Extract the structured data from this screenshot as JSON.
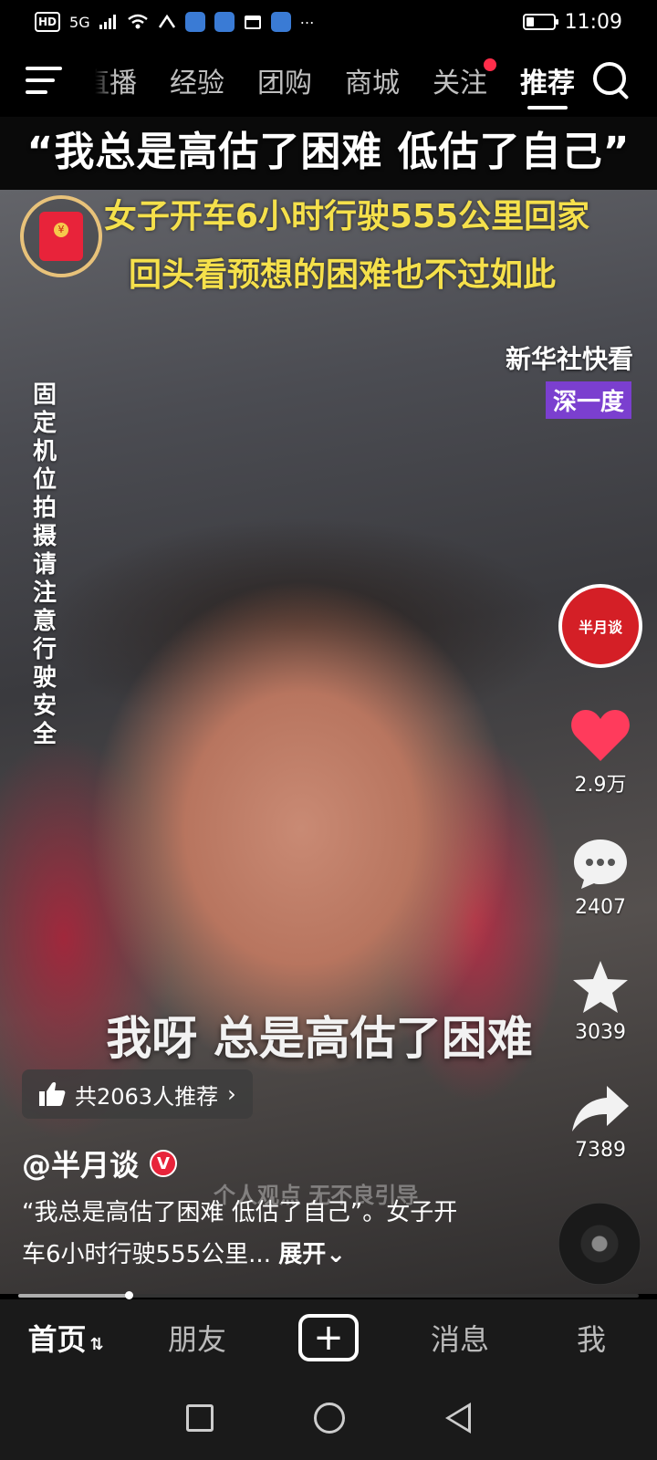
{
  "status_bar": {
    "network": "5G",
    "hd_label": "HD",
    "time": "11:09",
    "battery_level": 0.4
  },
  "top_nav": {
    "tabs": [
      {
        "label": "直播"
      },
      {
        "label": "经验"
      },
      {
        "label": "团购"
      },
      {
        "label": "商城"
      },
      {
        "label": "关注"
      },
      {
        "label": "推荐"
      }
    ],
    "active_tab": "推荐"
  },
  "video": {
    "title": "“我总是高估了困难 低估了自己”",
    "caption_line1": "女子开车6小时行驶555公里回家",
    "caption_line2": "回头看预想的困难也不过如此",
    "brand_mark": "新华社快看",
    "brand_sub": "深一度",
    "vertical_notice": "固定机位拍摄 请注意行驶安全",
    "subtitle": "我呀 总是高估了困难",
    "watermark": "个人观点 无不良引导"
  },
  "actions": {
    "avatar_text": "半月谈",
    "likes": "2.9万",
    "comments": "2407",
    "favorites": "3039",
    "shares": "7389"
  },
  "recommend": {
    "label": "共2063人推荐"
  },
  "post": {
    "author": "@半月谈",
    "description": "“我总是高估了困难 低估了自己”。女子开车6小时行驶555公里...",
    "expand_label": "展开"
  },
  "progress": 0.18,
  "bottom_tabs": {
    "home": "首页",
    "friends": "朋友",
    "messages": "消息",
    "me": "我"
  }
}
